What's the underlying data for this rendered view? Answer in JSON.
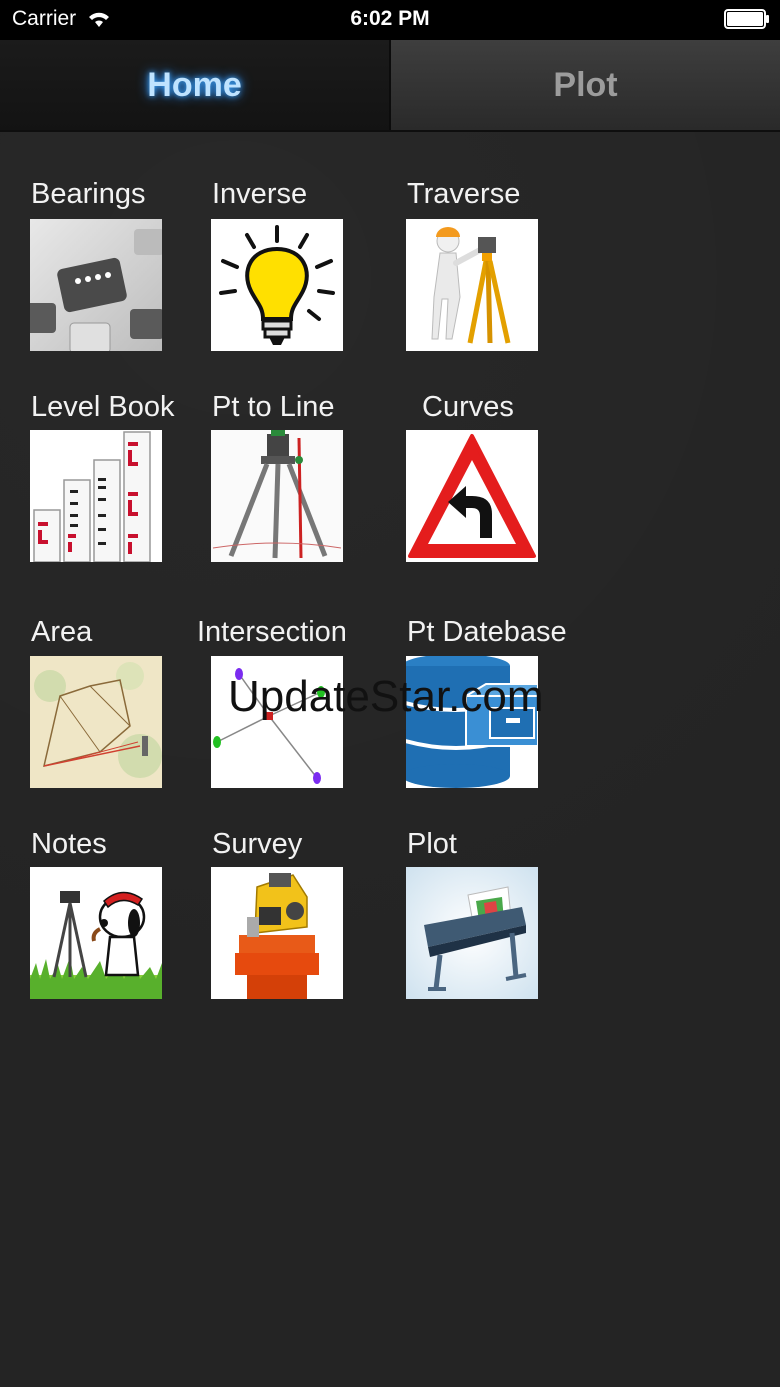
{
  "status_bar": {
    "carrier": "Carrier",
    "time": "6:02 PM"
  },
  "tabs": [
    {
      "label": "Home",
      "active": true
    },
    {
      "label": "Plot",
      "active": false
    }
  ],
  "tiles": {
    "bearings": "Bearings",
    "inverse": "Inverse",
    "traverse": "Traverse",
    "level_book": "Level Book",
    "pt_to_line": "Pt to Line",
    "curves": "Curves",
    "area": "Area",
    "intersection": "Intersection",
    "pt_database": "Pt Datebase",
    "notes": "Notes",
    "survey": "Survey",
    "plot": "Plot"
  },
  "watermark": "UpdateStar.com",
  "colors": {
    "background": "#242424",
    "active_tab_text": "#bfe3ff",
    "inactive_tab_text": "#9c9c9c"
  }
}
